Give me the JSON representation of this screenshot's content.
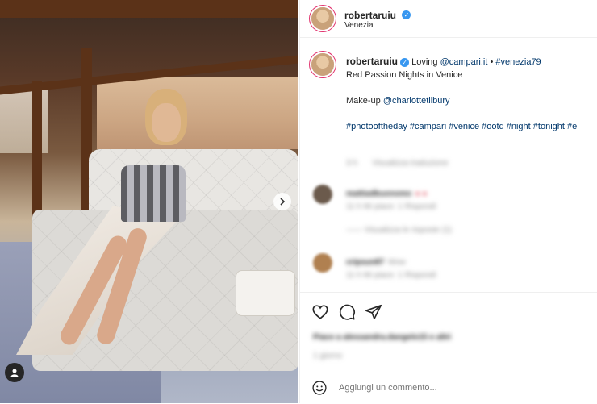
{
  "post": {
    "username": "robertaruiu",
    "location": "Venezia",
    "caption": {
      "username": "robertaruiu",
      "line1_prefix": "Loving",
      "mention1": "@campari.it",
      "separator": "•",
      "hashtag1": "#venezia79",
      "line2": "Red Passion Nights in Venice",
      "makeup_label": "Make-up",
      "mention2": "@charlottetilbury",
      "hashtags": "#photooftheday #campari #venice #ootd #night #tonight #e"
    },
    "blurred": {
      "caption_meta_time": "3 h",
      "caption_meta_action": "Visualizza traduzione",
      "comment1_user": "mattiadbuonomo",
      "comment1_text": "● ●",
      "comment1_meta": "11 h   Mi piace: 1   Rispondi",
      "comment1_replies": "——  Visualizza le risposte (1)",
      "comment2_user": "cripsun87",
      "comment2_text": "Wow",
      "comment2_meta": "11 h   Mi piace: 1   Rispondi",
      "likes": "Piace a alessandra.dangelo15 e altri",
      "time": "1 giorno"
    },
    "comment_placeholder": "Aggiungi un commento...",
    "icons": {
      "like": "heart-icon",
      "comment": "comment-icon",
      "share": "paper-plane-icon",
      "emoji": "emoji-icon",
      "next": "chevron-right-icon",
      "tagged": "user-tag-icon"
    }
  }
}
